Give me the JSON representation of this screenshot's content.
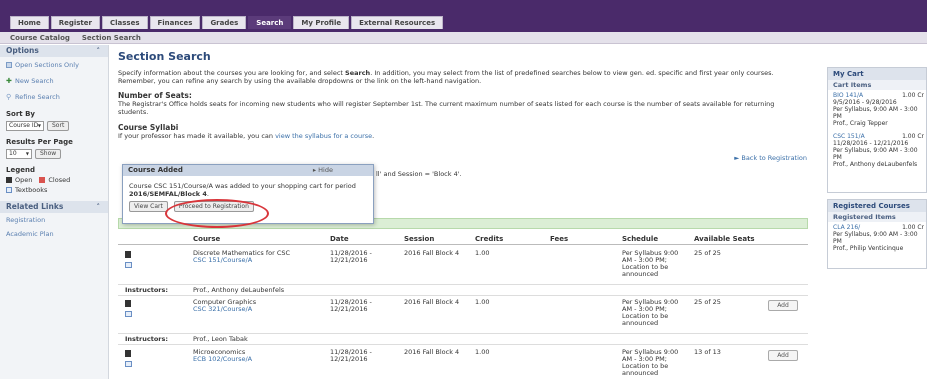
{
  "nav": {
    "tabs": [
      "Home",
      "Register",
      "Classes",
      "Finances",
      "Grades",
      "Search",
      "My Profile",
      "External Resources"
    ],
    "active_tab": "Search",
    "subnav": [
      "Course Catalog",
      "Section Search"
    ]
  },
  "sidebar": {
    "options_title": "Options",
    "options": [
      "Open Sections Only",
      "New Search",
      "Refine Search"
    ],
    "sort_by_label": "Sort By",
    "sort_by_value": "Course ID",
    "sort_button": "Sort",
    "results_label": "Results Per Page",
    "results_value": "10",
    "show_button": "Show",
    "legend_label": "Legend",
    "legend_open": "Open",
    "legend_closed": "Closed",
    "legend_textbooks": "Textbooks",
    "related_title": "Related Links",
    "related_links": [
      "Registration",
      "Academic Plan"
    ],
    "colors": {
      "open": "#333333",
      "closed": "#d9534f"
    }
  },
  "main": {
    "title": "Section Search",
    "intro_a": "Specify information about the courses you are looking for, and select ",
    "intro_search": "Search",
    "intro_b": ". In addition, you may select from the list of predefined searches below to view gen. ed. specific and first year only courses.",
    "intro_c": "Remember, you can refine any search by using the available dropdowns or the link on the left-hand navigation.",
    "seats_title": "Number of Seats:",
    "seats_text_1": "The Registrar's Office holds seats for incoming new students who will register September 1st. The current maximum number of seats listed for each course is the number of seats available for returning",
    "seats_text_2": "students.",
    "syllabi_title": "Course Syllabi",
    "syllabi_text": "If your professor has made it available, you can ",
    "syllabi_link": "view the syllabus for a course",
    "syllabi_end": ".",
    "back_link": "► Back to Registration",
    "criteria_tail": "ll' and Session = 'Block 4'."
  },
  "popup": {
    "title": "Course Added",
    "hide": "▸ Hide",
    "msg_a": "Course ",
    "msg_course": "CSC 151/Course/A",
    "msg_b": " was added to your shopping cart for period",
    "msg_period": "2016/SEMFAL/Block 4",
    "msg_end": ".",
    "view_cart": "View Cart",
    "proceed": "Proceed to Registration"
  },
  "table": {
    "headers": [
      "Course",
      "Date",
      "Session",
      "Credits",
      "Fees",
      "Schedule",
      "Available Seats"
    ],
    "instructors_label": "Instructors:",
    "add_label": "Add",
    "rows": [
      {
        "title": "Discrete Mathematics for CSC",
        "code": "CSC 151/Course/A",
        "date1": "11/28/2016 -",
        "date2": "12/21/2016",
        "session": "2016 Fall Block 4",
        "credits": "1.00",
        "sched1": "Per Syllabus 9:00",
        "sched2": "AM - 3:00 PM;",
        "sched3": "Location to be",
        "sched4": "announced",
        "seats": "25 of 25",
        "instructor": "Prof., Anthony deLaubenfels",
        "has_add": false
      },
      {
        "title": "Computer Graphics",
        "code": "CSC 321/Course/A",
        "date1": "11/28/2016 -",
        "date2": "12/21/2016",
        "session": "2016 Fall Block 4",
        "credits": "1.00",
        "sched1": "Per Syllabus 9:00",
        "sched2": "AM - 3:00 PM;",
        "sched3": "Location to be",
        "sched4": "announced",
        "seats": "25 of 25",
        "instructor": "Prof., Leon Tabak",
        "has_add": true
      },
      {
        "title": "Microeconomics",
        "code": "ECB 102/Course/A",
        "date1": "11/28/2016 -",
        "date2": "12/21/2016",
        "session": "2016 Fall Block 4",
        "credits": "1.00",
        "sched1": "Per Syllabus 9:00",
        "sched2": "AM - 3:00 PM;",
        "sched3": "Location to be",
        "sched4": "announced",
        "seats": "13 of 13",
        "instructor": "",
        "has_add": true
      }
    ]
  },
  "cart": {
    "title": "My Cart",
    "sub": "Cart Items",
    "items": [
      {
        "code": "BIO 141/A",
        "credits": "1.00 Cr",
        "l1": "9/5/2016 - 9/28/2016",
        "l2": "Per Syllabus, 9:00 AM - 3:00",
        "l3": "PM",
        "l4": "Prof., Craig Tepper"
      },
      {
        "code": "CSC 151/A",
        "credits": "1.00 Cr",
        "l1": "11/28/2016 - 12/21/2016",
        "l2": "Per Syllabus, 9:00 AM - 3:00",
        "l3": "PM",
        "l4": "Prof., Anthony deLaubenfels"
      }
    ]
  },
  "registered": {
    "title": "Registered Courses",
    "sub": "Registered Items",
    "items": [
      {
        "code": "CLA 216/",
        "credits": "1.00 Cr",
        "l1": "Per Syllabus, 9:00 AM - 3:00",
        "l2": "PM",
        "l3": "Prof., Philip Venticinque"
      }
    ]
  }
}
